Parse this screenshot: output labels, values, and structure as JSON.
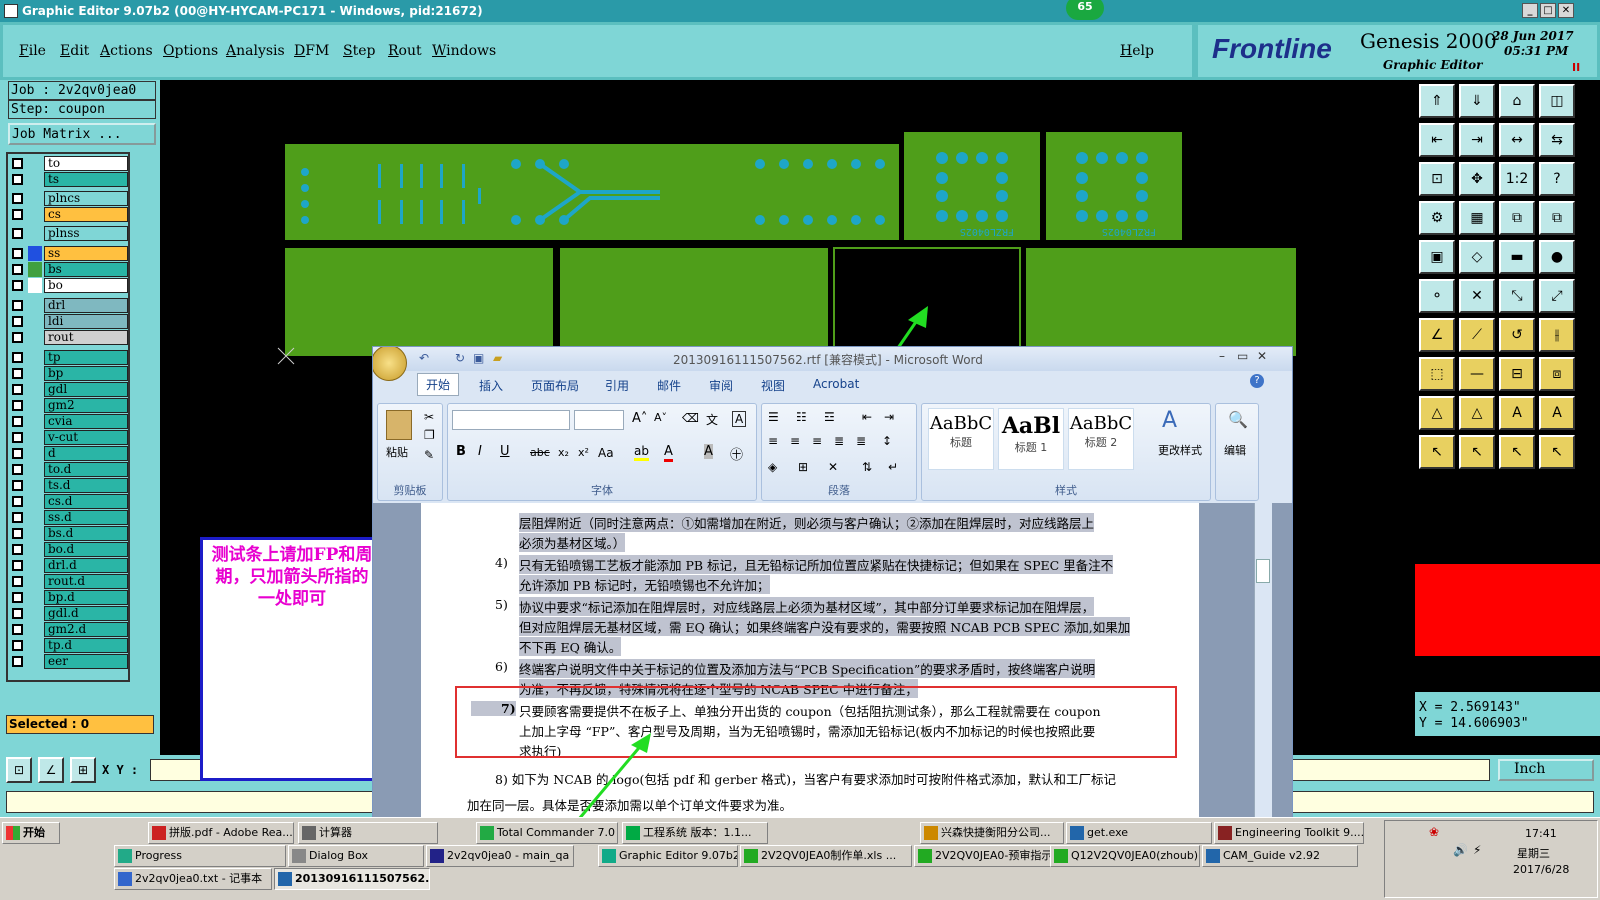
{
  "window": {
    "title": "Graphic Editor 9.07b2 (00@HY-HYCAM-PC171 - Windows, pid:21672)",
    "badge": "65"
  },
  "menu": [
    "File",
    "Edit",
    "Actions",
    "Options",
    "Analysis",
    "DFM",
    "Step",
    "Rout",
    "Windows"
  ],
  "help": "Help",
  "brand": {
    "logo": "Frontline",
    "product": "Genesis 2000",
    "sub": "Graphic Editor",
    "date": "28 Jun 2017",
    "time": "05:31 PM"
  },
  "job": {
    "job_label": "Job : 2v2qv0jea0",
    "step_label": "Step: coupon",
    "matrix_button": "Job Matrix ..."
  },
  "layers": [
    {
      "name": "to",
      "color": "#ffffff",
      "swatch": ""
    },
    {
      "name": "ts",
      "color": "#2ab5a6",
      "swatch": ""
    },
    {
      "name": "plncs",
      "color": "#7fd6d6",
      "swatch": ""
    },
    {
      "name": "cs",
      "color": "#ffc040",
      "swatch": ""
    },
    {
      "name": "plnss",
      "color": "#7fd6d6",
      "swatch": ""
    },
    {
      "name": "ss",
      "color": "#ffc040",
      "swatch": "#2050e0"
    },
    {
      "name": "bs",
      "color": "#2ab5a6",
      "swatch": "#40a040"
    },
    {
      "name": "bo",
      "color": "#ffffff",
      "swatch": "#ffffff"
    },
    {
      "name": "drl",
      "color": "#7fb8c0",
      "swatch": ""
    },
    {
      "name": "ldi",
      "color": "#7fb8c0",
      "swatch": ""
    },
    {
      "name": "rout",
      "color": "#d0d0d0",
      "swatch": ""
    },
    {
      "name": "tp",
      "color": "#2ab5a6",
      "swatch": ""
    },
    {
      "name": "bp",
      "color": "#2ab5a6",
      "swatch": ""
    },
    {
      "name": "gdl",
      "color": "#2ab5a6",
      "swatch": ""
    },
    {
      "name": "gm2",
      "color": "#2ab5a6",
      "swatch": ""
    },
    {
      "name": "cvia",
      "color": "#2ab5a6",
      "swatch": ""
    },
    {
      "name": "v-cut",
      "color": "#2ab5a6",
      "swatch": ""
    },
    {
      "name": "d",
      "color": "#2ab5a6",
      "swatch": ""
    },
    {
      "name": "to.d",
      "color": "#2ab5a6",
      "swatch": ""
    },
    {
      "name": "ts.d",
      "color": "#2ab5a6",
      "swatch": ""
    },
    {
      "name": "cs.d",
      "color": "#2ab5a6",
      "swatch": ""
    },
    {
      "name": "ss.d",
      "color": "#2ab5a6",
      "swatch": ""
    },
    {
      "name": "bs.d",
      "color": "#2ab5a6",
      "swatch": ""
    },
    {
      "name": "bo.d",
      "color": "#2ab5a6",
      "swatch": ""
    },
    {
      "name": "drl.d",
      "color": "#2ab5a6",
      "swatch": ""
    },
    {
      "name": "rout.d",
      "color": "#2ab5a6",
      "swatch": ""
    },
    {
      "name": "bp.d",
      "color": "#2ab5a6",
      "swatch": ""
    },
    {
      "name": "gdl.d",
      "color": "#2ab5a6",
      "swatch": ""
    },
    {
      "name": "gm2.d",
      "color": "#2ab5a6",
      "swatch": ""
    },
    {
      "name": "tp.d",
      "color": "#2ab5a6",
      "swatch": ""
    },
    {
      "name": "eer",
      "color": "#2ab5a6",
      "swatch": ""
    }
  ],
  "selected": "Selected : 0",
  "xy_label": "X Y :",
  "units": "Inch",
  "coords": {
    "x": "X = 2.569143\"",
    "y": "Y = 14.606903\""
  },
  "coupon_text": "FRZL0402S",
  "annotation": "测试条上请加FP和周期，只加箭头所指的一处即可",
  "word": {
    "title": "20130916111507562.rtf [兼容模式] - Microsoft Word",
    "tabs": [
      "开始",
      "插入",
      "页面布局",
      "引用",
      "邮件",
      "审阅",
      "视图",
      "Acrobat"
    ],
    "groups": {
      "clipboard": "剪贴板",
      "font": "字体",
      "paragraph": "段落",
      "styles": "样式",
      "paste": "粘贴",
      "change_styles": "更改样式",
      "edit": "编辑"
    },
    "styles": [
      {
        "sample": "AaBbC",
        "name": "标题"
      },
      {
        "sample": "AaBl",
        "name": "标题 1"
      },
      {
        "sample": "AaBbC",
        "name": "标题 2"
      }
    ],
    "lines": [
      "层阻焊附近（同时注意两点：①如需增加在附近，则必须与客户确认；②添加在阻焊层时，对应线路层上",
      "必须为基材区域。）",
      "只有无铅喷锡工艺板才能添加 PB 标记，且无铅标记所加位置应紧贴在快捷标记；但如果在 SPEC 里备注不",
      "允许添加 PB 标记时，无铅喷锡也不允许加；",
      "协议中要求“标记添加在阻焊层时，对应线路层上必须为基材区域”，其中部分订单要求标记加在阻焊层，",
      "但对应阻焊层无基材区域，需 EQ 确认；如果终端客户没有要求的，需要按照 NCAB PCB SPEC 添加,如果加",
      "不下再 EQ 确认。",
      "终端客户说明文件中关于标记的位置及添加方法与“PCB Specification”的要求矛盾时，按终端客户说明",
      "为准，不再反馈，特殊情况将在逐个型号的 NCAB SPEC 中进行备注；",
      "只要顾客需要提供不在板子上、单独分开出货的 coupon（包括阻抗测试条），那么工程就需要在 coupon",
      "上加上字母 “FP”、客户型号及周期，当为无铅喷锡时，需添加无铅标记(板内不加标记的时候也按照此要",
      "求执行)",
      "8) 如下为 NCAB 的 logo(包括 pdf 和 gerber 格式)，当客户有要求添加时可按附件格式添加，默认和工厂标记",
      "加在同一层。具体是否要添加需以单个订单文件要求为准。"
    ],
    "nums": [
      "4)",
      "5)",
      "6)",
      "7)"
    ]
  },
  "taskbar": {
    "start": "开始",
    "tasks": [
      "拼版.pdf - Adobe Rea...",
      "计算器",
      "Total Commander 7.0 ...",
      "工程系统  版本：1.1...",
      "兴森快捷衡阳分公司...",
      "get.exe",
      "Engineering Toolkit 9....",
      "Progress",
      "Dialog Box",
      "2v2qv0jea0 - main_qa",
      "Graphic Editor 9.07b2 (0...",
      "2V2QV0JEA0制作单.xls ...",
      "2V2QV0JEA0-预审指示...",
      "Q12V2QV0JEA0(zhoub)...",
      "CAM_Guide v2.92",
      "2v2qv0jea0.txt - 记事本",
      "20130916111507562..."
    ],
    "clock": "17:41",
    "weekday": "星期三",
    "date": "2017/6/28"
  },
  "colors": {
    "panel": "#7fd6d6",
    "board": "#4f9e1a",
    "pad": "#1ea6c8",
    "arrow": "#22dd22"
  }
}
